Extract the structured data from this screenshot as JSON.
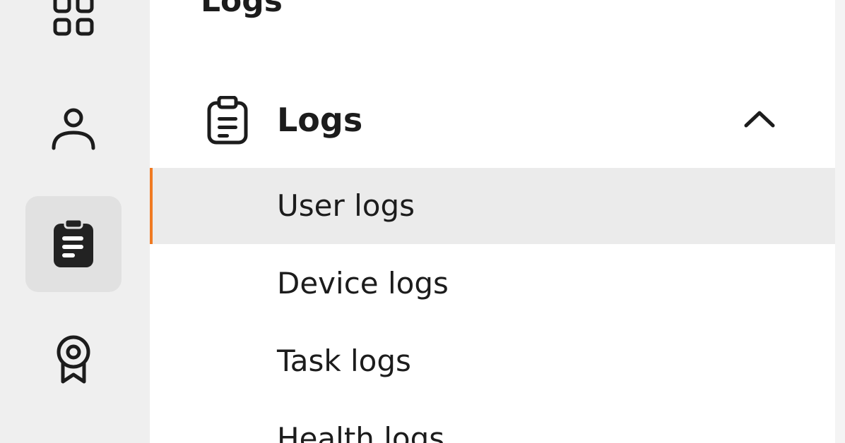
{
  "panel": {
    "title": "Logs"
  },
  "rail": {
    "items": [
      {
        "icon": "apps-grid-icon",
        "active": false
      },
      {
        "icon": "user-icon",
        "active": false
      },
      {
        "icon": "clipboard-icon",
        "active": true
      },
      {
        "icon": "award-badge-icon",
        "active": false
      }
    ]
  },
  "nav": {
    "group": {
      "label": "Logs",
      "icon": "clipboard-outline-icon",
      "expanded": true,
      "toggle_icon": "chevron-up-icon"
    },
    "items": [
      {
        "label": "User logs",
        "active": true
      },
      {
        "label": "Device logs",
        "active": false
      },
      {
        "label": "Task logs",
        "active": false
      },
      {
        "label": "Health logs",
        "active": false
      }
    ]
  },
  "colors": {
    "accent": "#f07a22",
    "rail_background": "#efefef",
    "active_item_background": "#ebebeb",
    "text": "#1c1c1c"
  }
}
